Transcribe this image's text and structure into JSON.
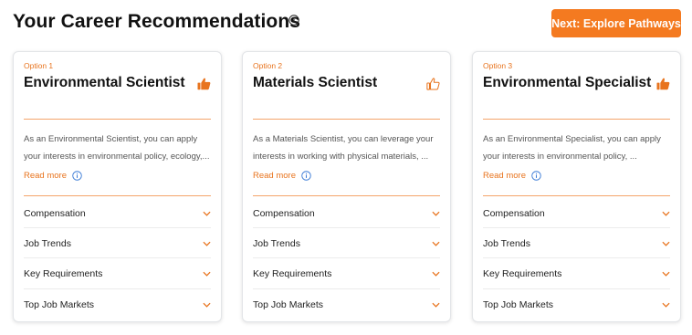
{
  "header": {
    "title": "Your Career Recommendations",
    "next_button": "Next: Explore Pathways"
  },
  "colors": {
    "accent": "#f47a20",
    "divider": "#f4a56b"
  },
  "cards": [
    {
      "option": "Option 1",
      "title": "Environmental Scientist",
      "thumb": "thumbs-up-filled-icon",
      "desc_line1": "As an Environmental Scientist, you can apply",
      "desc_line2": "your interests in environmental policy, ecology,...",
      "read_more": "Read more",
      "accordion": [
        "Compensation",
        "Job Trends",
        "Key Requirements",
        "Top Job Markets"
      ]
    },
    {
      "option": "Option 2",
      "title": "Materials Scientist",
      "thumb": "thumbs-up-outline-icon",
      "desc_line1": "As a Materials Scientist, you can leverage your",
      "desc_line2": "interests in working with physical materials, ...",
      "read_more": "Read more",
      "accordion": [
        "Compensation",
        "Job Trends",
        "Key Requirements",
        "Top Job Markets"
      ]
    },
    {
      "option": "Option 3",
      "title": "Environmental Specialist",
      "thumb": "thumbs-up-filled-icon",
      "desc_line1": "As an Environmental Specialist, you can apply",
      "desc_line2": "your interests in environmental policy, ...",
      "read_more": "Read more",
      "accordion": [
        "Compensation",
        "Job Trends",
        "Key Requirements",
        "Top Job Markets"
      ]
    }
  ]
}
